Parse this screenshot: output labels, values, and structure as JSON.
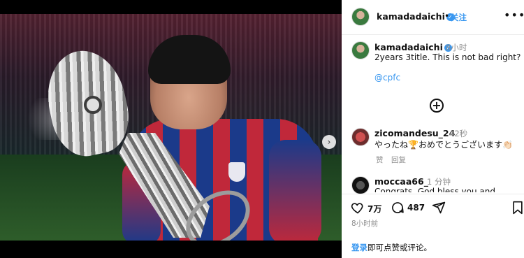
{
  "post": {
    "username": "kamadadaichi",
    "verified_icon": "verified-badge-icon",
    "separator": "•",
    "follow_label": "关注",
    "more_icon": "more-horizontal-icon",
    "more_glyph": "•••"
  },
  "media": {
    "next_icon": "chevron-right-icon",
    "next_glyph": "›",
    "slide_count": 5,
    "active_slide": 1
  },
  "caption": {
    "username": "kamadadaichi",
    "time": "8小时",
    "text": "2years 3title. This is not bad right?",
    "mention": "@cpfc"
  },
  "load_more_icon": "plus-circle-icon",
  "load_more_glyph": "+",
  "comments": [
    {
      "username": "zicomandesu_24",
      "time": "42秒",
      "text": "やったね🏆おめでとうございます👏🏻",
      "like_label": "赞",
      "reply_label": "回复"
    },
    {
      "username": "moccaa66_",
      "time": "1 分钟",
      "text": "Congrats, God bless you and your..."
    }
  ],
  "actions": {
    "likes": "7万",
    "comments": "487",
    "ago": "8小时前",
    "login_link": "登录",
    "login_rest": "即可点赞或评论。"
  },
  "colors": {
    "accent": "#3897f0",
    "muted": "#8e8e8e",
    "text": "#111111",
    "background": "#000000"
  }
}
